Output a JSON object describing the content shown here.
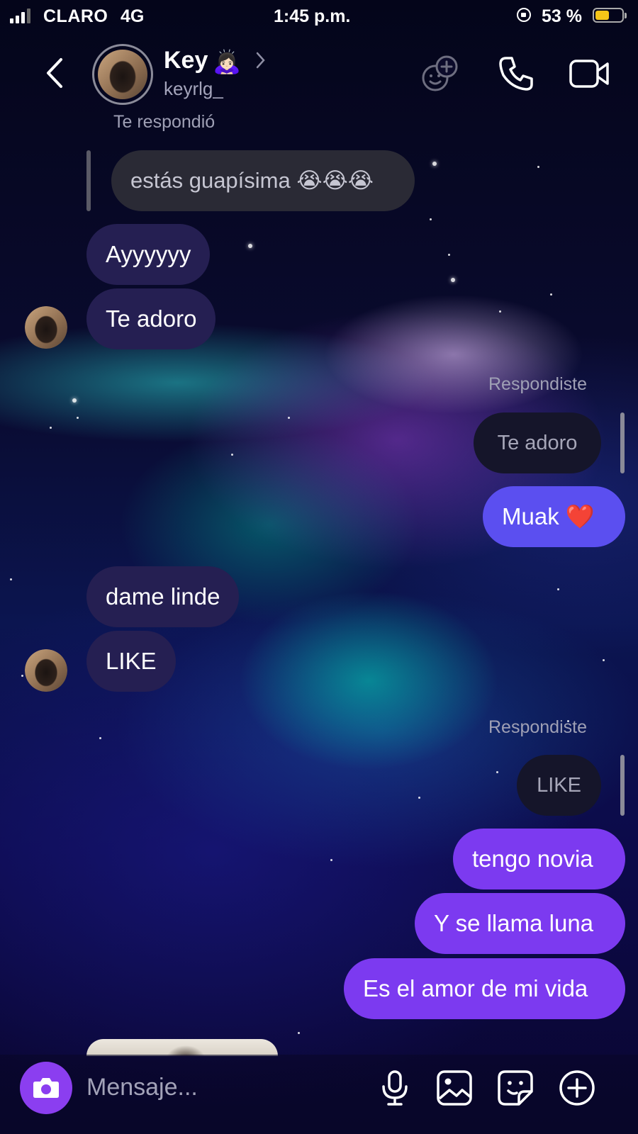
{
  "status_bar": {
    "carrier": "CLARO",
    "network": "4G",
    "time": "1:45 p.m.",
    "battery_text": "53 %",
    "battery_level": 0.53,
    "battery_color": "#f5c518"
  },
  "header": {
    "back_icon": "chevron-left-icon",
    "name": "Key",
    "emoji": "🙇🏻‍♀️",
    "username": "keyrlg_",
    "actions": [
      "add-effect-icon",
      "phone-icon",
      "video-camera-icon"
    ]
  },
  "messages": {
    "reply_label_in": "Te respondió",
    "quoted_in": "estás guapísima 😭😭😭",
    "m1": "Ayyyyyy",
    "m2": "Te adoro",
    "reply_label_out_1": "Respondiste",
    "quoted_out_1": "Te adoro",
    "m3": "Muak ❤️",
    "m4": "dame linde",
    "m5": "LIKE",
    "reply_label_out_2": "Respondiste",
    "quoted_out_2": "LIKE",
    "m6": "tengo novia",
    "m7": "Y se llama luna",
    "m8": "Es el amor de mi vida"
  },
  "composer": {
    "placeholder": "Mensaje...",
    "icons": [
      "camera-icon",
      "microphone-icon",
      "gallery-icon",
      "sticker-icon",
      "plus-circle-icon"
    ]
  },
  "colors": {
    "incoming_bubble": "#251f52",
    "outgoing_blue": "#5b4ff0",
    "outgoing_purple": "#7c3af0",
    "camera_button": "#8b3ef0"
  }
}
